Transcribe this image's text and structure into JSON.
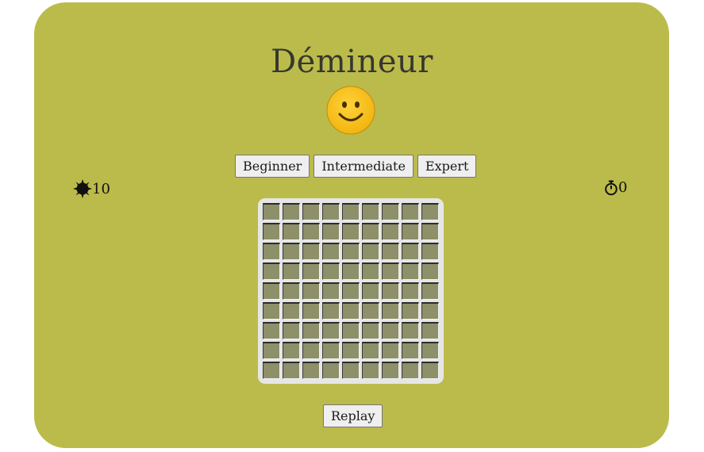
{
  "game": {
    "title": "Démineur",
    "face": "smiley-face-icon",
    "levels": [
      "Beginner",
      "Intermediate",
      "Expert"
    ],
    "mine_count": "10",
    "timer": "0",
    "mine_icon": "mine-icon",
    "timer_icon": "stopwatch-icon",
    "rows": 9,
    "cols": 9,
    "replay_label": "Replay"
  },
  "colors": {
    "background": "#bbbb4b",
    "cell": "#8d9068",
    "board": "#e6e6e6",
    "face": "#f5bd19"
  }
}
